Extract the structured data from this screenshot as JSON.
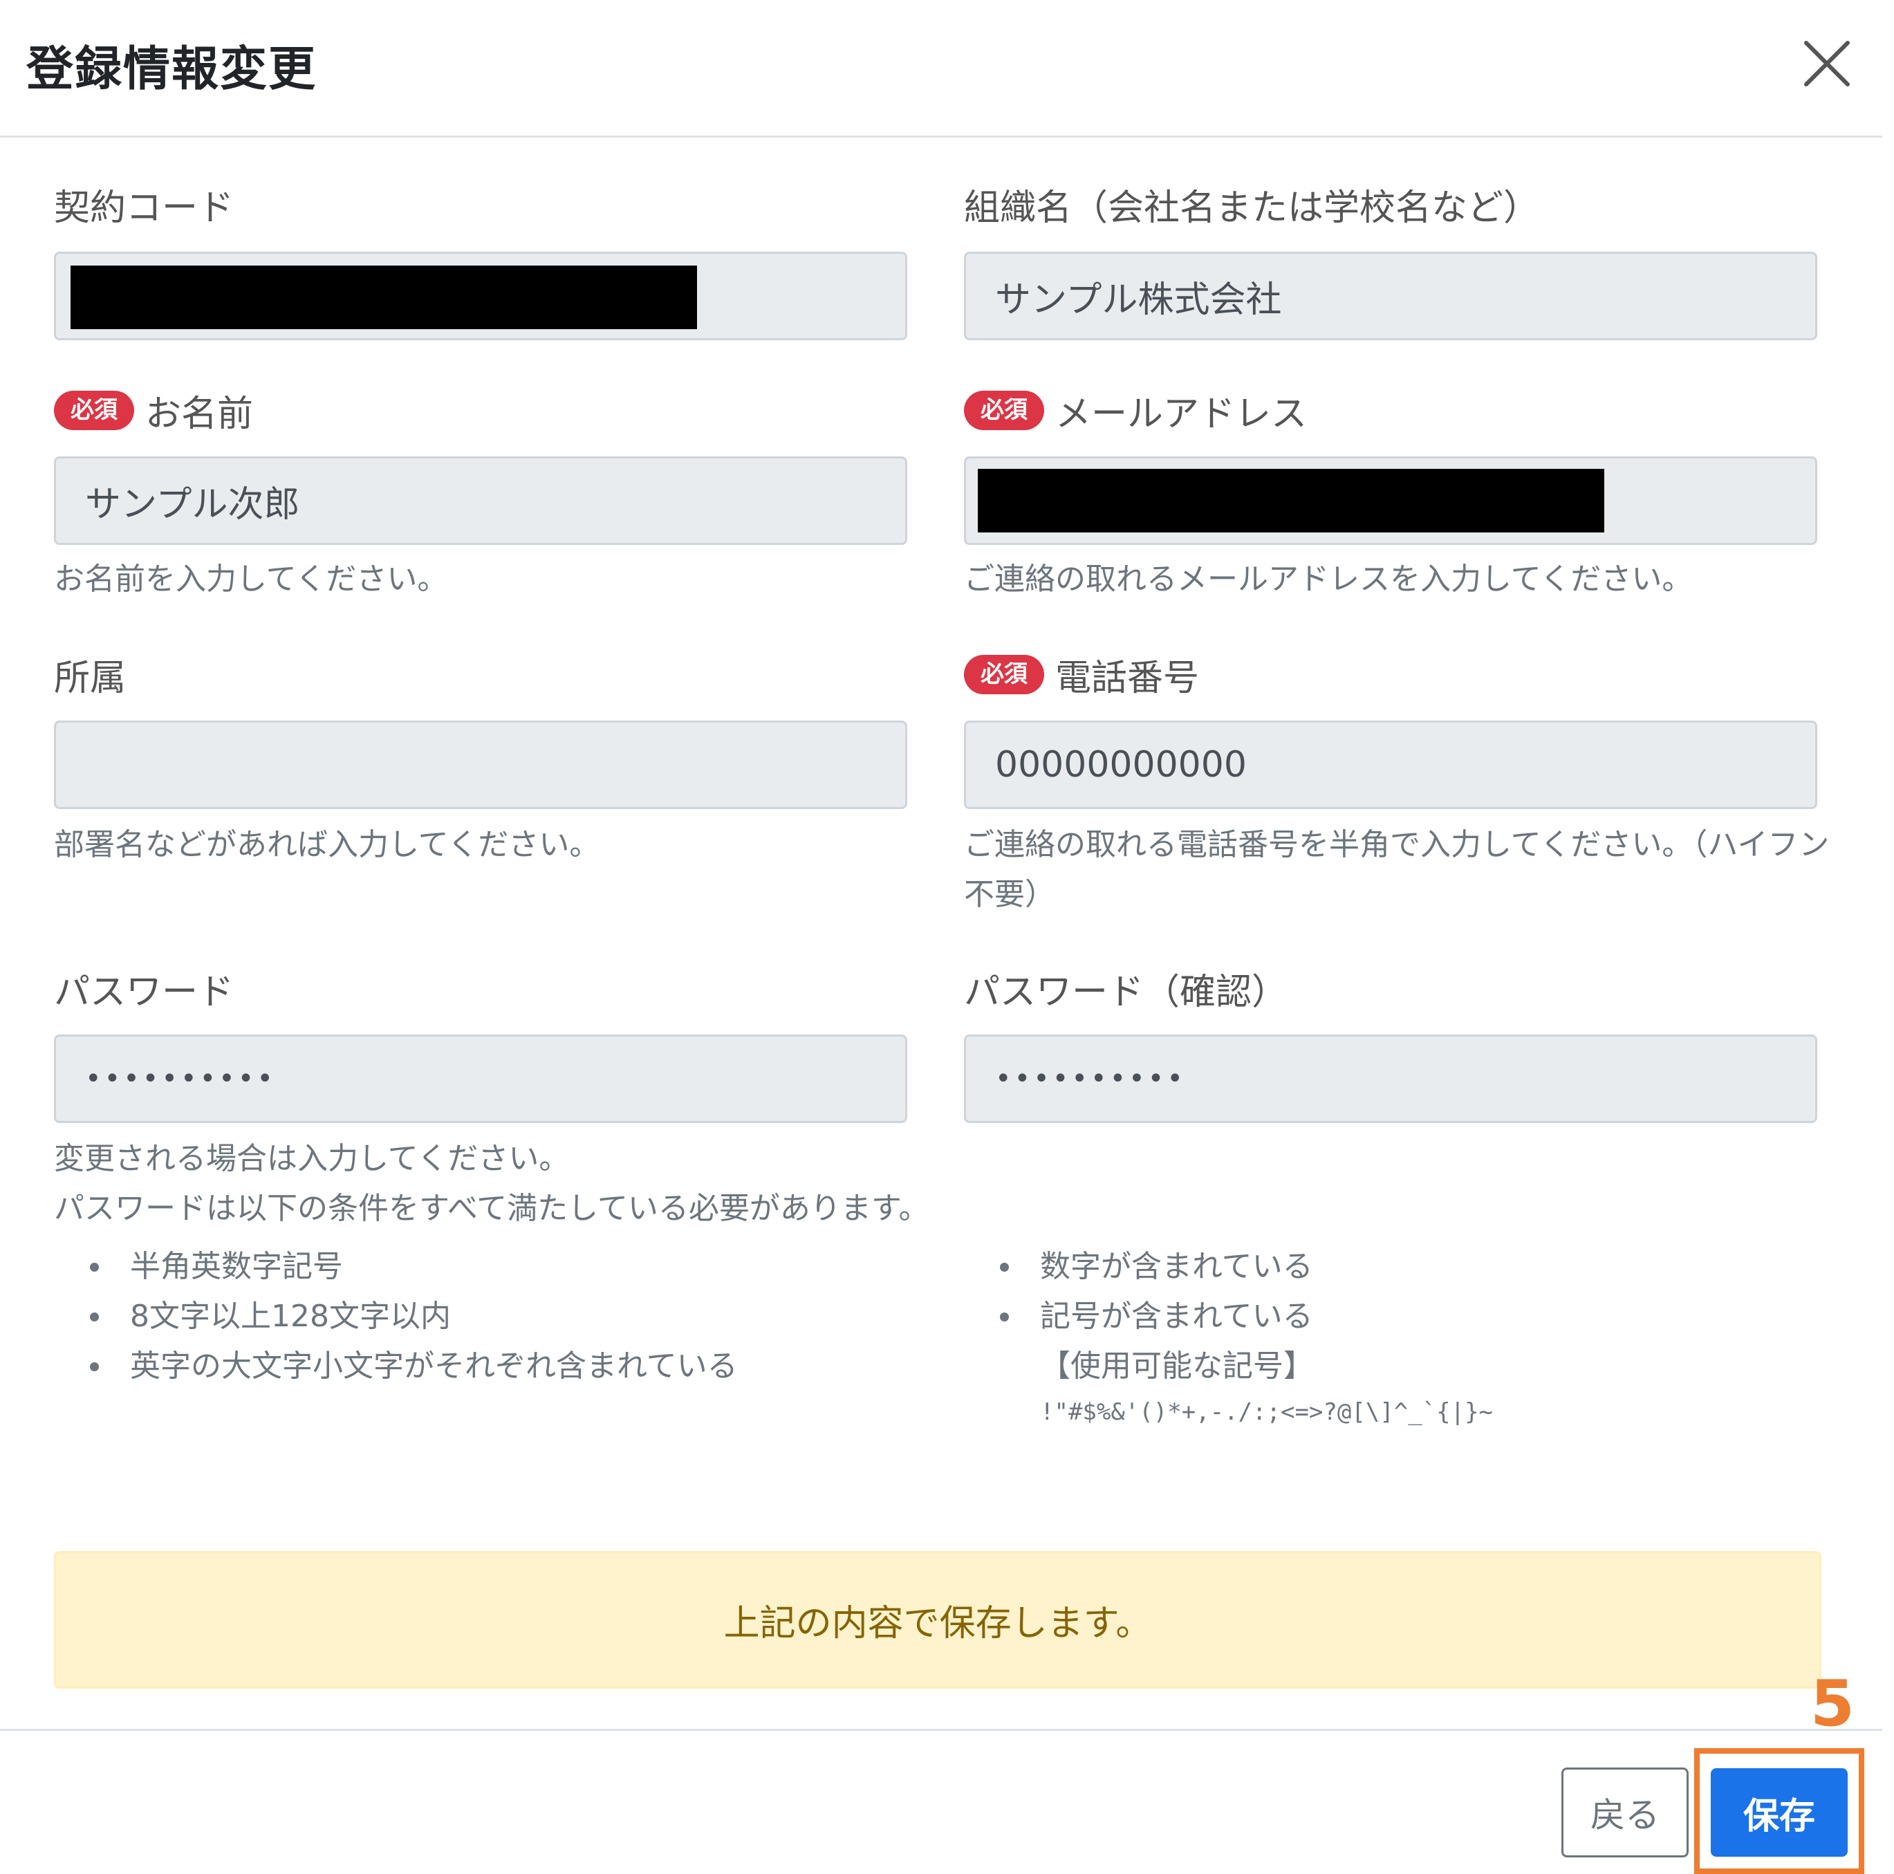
{
  "modal": {
    "title": "登録情報変更",
    "close_icon": "close-icon"
  },
  "fields": {
    "contract_code": {
      "label": "契約コード",
      "value": ""
    },
    "organization": {
      "label": "組織名（会社名または学校名など）",
      "value": "サンプル株式会社"
    },
    "name": {
      "required_badge": "必須",
      "label": "お名前",
      "value": "サンプル次郎",
      "help": "お名前を入力してください。"
    },
    "email": {
      "required_badge": "必須",
      "label": "メールアドレス",
      "value": "",
      "help": "ご連絡の取れるメールアドレスを入力してください。"
    },
    "department": {
      "label": "所属",
      "value": "",
      "help": "部署名などがあれば入力してください。"
    },
    "phone": {
      "required_badge": "必須",
      "label": "電話番号",
      "value": "00000000000",
      "help_line1": "ご連絡の取れる電話番号を半角で入力してください。（ハイフン",
      "help_line2": "不要）"
    },
    "password": {
      "label": "パスワード",
      "value": "••••••••••",
      "help_line1": "変更される場合は入力してください。",
      "help_line2": "パスワードは以下の条件をすべて満たしている必要があります。"
    },
    "password_confirm": {
      "label": "パスワード（確認）",
      "value": "••••••••••"
    }
  },
  "password_rules_left": [
    "半角英数字記号",
    "8文字以上128文字以内",
    "英字の大文字小文字がそれぞれ含まれている"
  ],
  "password_rules_right": [
    "数字が含まれている",
    "記号が含まれている"
  ],
  "allowed_symbols_label": "【使用可能な記号】",
  "allowed_symbols": "!\"#$%&'()*+,-./:;<=>?@[\\]^_`{|}~",
  "alert": {
    "message": "上記の内容で保存します。"
  },
  "footer": {
    "back_label": "戻る",
    "save_label": "保存"
  },
  "annotation": {
    "step_number": "5"
  },
  "colors": {
    "primary": "#1a73e8",
    "required_badge": "#dc3545",
    "alert_bg": "#fff3cd",
    "highlight": "#ed7d31"
  }
}
